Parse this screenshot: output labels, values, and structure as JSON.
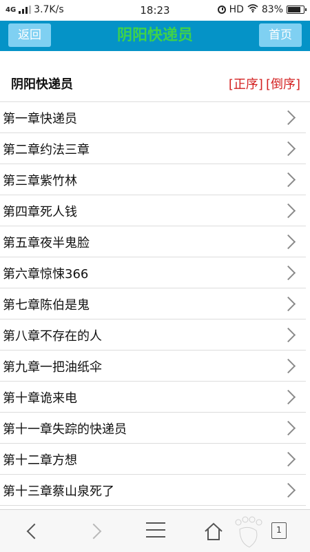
{
  "status_bar": {
    "network": "4G",
    "speed": "3.7K/s",
    "time": "18:23",
    "hd": "HD",
    "battery_percent": "83%",
    "battery_level": 0.83
  },
  "header": {
    "back_label": "返回",
    "title": "阴阳快递员",
    "home_label": "首页",
    "bar_color": "#0593c7",
    "title_color": "#3fd24a"
  },
  "book": {
    "title": "阴阳快递员",
    "sort_asc": "[正序]",
    "sort_desc": "[倒序]",
    "sort_color": "#d32020"
  },
  "chapters": [
    "第一章快递员",
    "第二章约法三章",
    "第三章紫竹林",
    "第四章死人钱",
    "第五章夜半鬼脸",
    "第六章惊悚366",
    "第七章陈伯是鬼",
    "第八章不存在的人",
    "第九章一把油纸伞",
    "第十章诡来电",
    "第十一章失踪的快递员",
    "第十二章方想",
    "第十三章蔡山泉死了"
  ],
  "bottom_bar": {
    "icons": [
      "back-arrow-icon",
      "forward-arrow-icon",
      "menu-icon",
      "home-icon",
      "tabs-icon"
    ],
    "tab_count": "1"
  }
}
